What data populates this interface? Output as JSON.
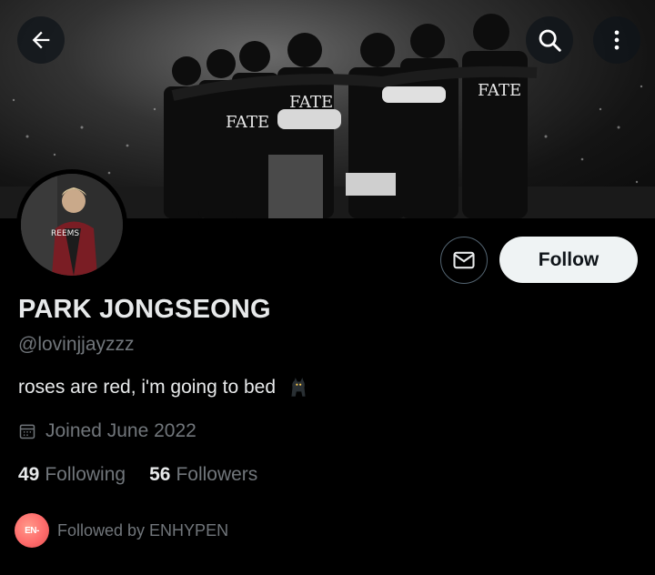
{
  "header": {
    "back_icon": "arrow-left-icon",
    "search_icon": "search-icon",
    "more_icon": "more-vertical-icon",
    "banner_shirt_text": "FATE"
  },
  "profile": {
    "display_name": "PARK JONGSEONG",
    "handle": "@lovinjjayzzz",
    "bio": "roses are red, i'm going to bed",
    "bio_emoji": "🐈‍⬛",
    "joined": "Joined June 2022",
    "joined_icon": "calendar-icon",
    "avatar_shirt_text": "REEMS"
  },
  "actions": {
    "message_icon": "envelope-icon",
    "follow_label": "Follow"
  },
  "stats": {
    "following_count": "49",
    "following_label": "Following",
    "followers_count": "56",
    "followers_label": "Followers"
  },
  "followed_by": {
    "text": "Followed by ENHYPEN",
    "avatar_label": "EN-"
  },
  "colors": {
    "background": "#000000",
    "primary_text": "#e7e9ea",
    "secondary_text": "#71767b",
    "follow_button_bg": "#eff3f4",
    "follow_button_text": "#0f1419",
    "followed_by_avatar": "#ff6b6b"
  }
}
